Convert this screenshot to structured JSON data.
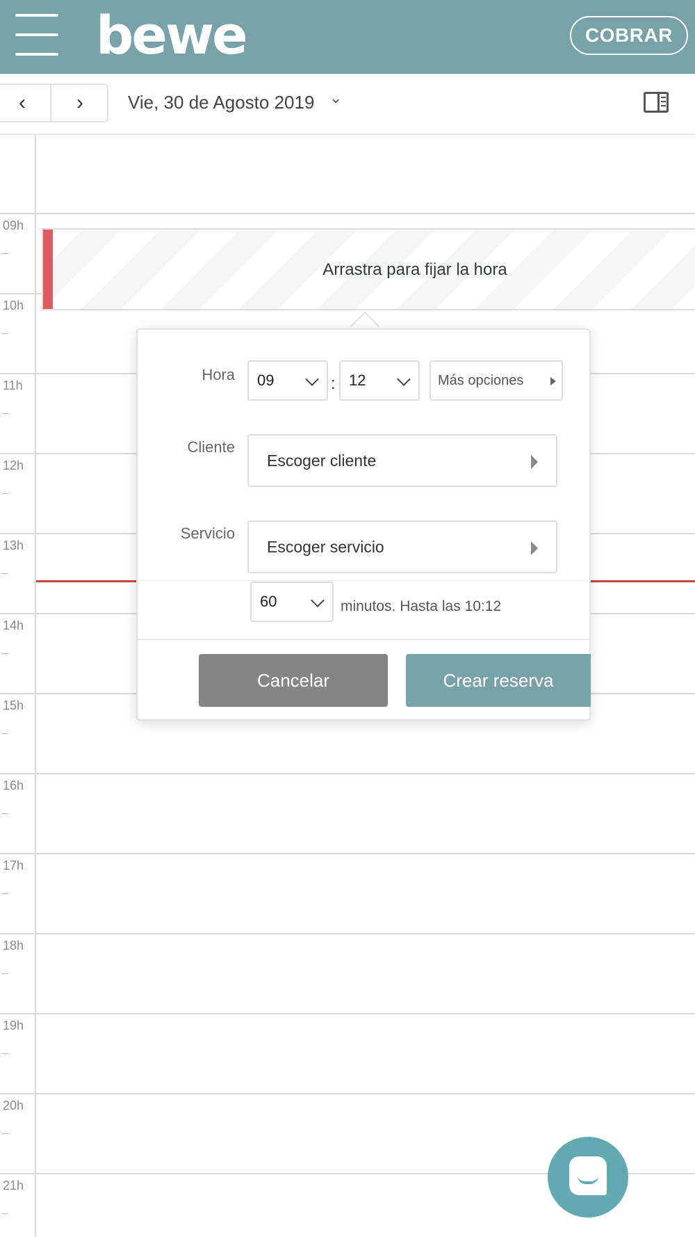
{
  "header": {
    "logo_text": "bewe",
    "charge_button": "COBRAR",
    "colors": {
      "brand": "#77a3a8",
      "now_line": "#c9463f",
      "event_marker": "#e05a61",
      "chat": "#63a9b1"
    }
  },
  "toolbar": {
    "prev_glyph": "‹",
    "next_glyph": "›",
    "date_label": "Vie, 30 de Agosto 2019",
    "date_caret": "⌄",
    "panel_icon": "side-panel-icon"
  },
  "calendar": {
    "hours": [
      "09h",
      "10h",
      "11h",
      "12h",
      "13h",
      "14h",
      "15h",
      "16h",
      "17h",
      "18h",
      "19h",
      "20h",
      "21h"
    ]
  },
  "drag_slot": {
    "text": "Arrastra para fijar la hora"
  },
  "booking_form": {
    "hour_label": "Hora",
    "hour_value": "09",
    "minute_value": "12",
    "separator": ":",
    "more_options": "Más opciones",
    "client_label": "Cliente",
    "client_placeholder": "Escoger cliente",
    "service_label": "Servicio",
    "service_placeholder": "Escoger servicio",
    "duration_value": "60",
    "duration_text": "minutos. Hasta las 10:12",
    "cancel_button": "Cancelar",
    "create_button": "Crear reserva"
  },
  "chat": {
    "icon": "chat-icon"
  }
}
